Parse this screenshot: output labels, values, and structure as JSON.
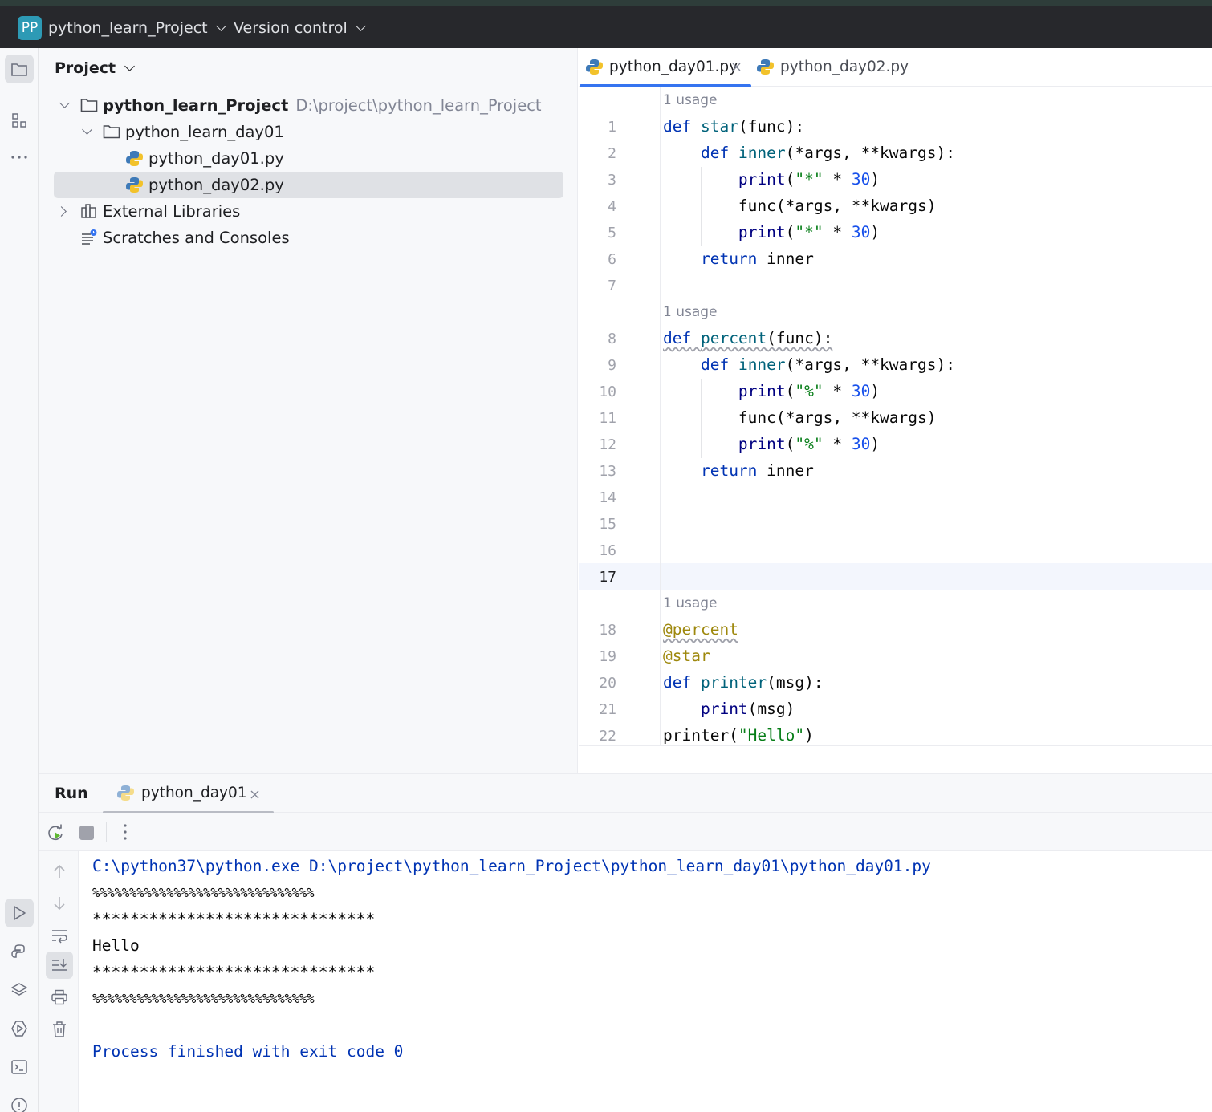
{
  "titlebar": {
    "project_badge": "PP",
    "project_name": "python_learn_Project",
    "vcs": "Version control"
  },
  "toolstrip": {
    "top": [
      "folder-icon",
      "structure-icon",
      "more-icon"
    ],
    "bottom": [
      "run-icon",
      "python-console-icon",
      "layers-icon",
      "services-icon",
      "terminal-icon",
      "problems-icon"
    ]
  },
  "project_panel": {
    "title": "Project",
    "tree": {
      "root": {
        "label": "python_learn_Project",
        "path": "D:\\project\\python_learn_Project"
      },
      "folder": "python_learn_day01",
      "file1": "python_day01.py",
      "file2": "python_day02.py",
      "external": "External Libraries",
      "scratches": "Scratches and Consoles"
    }
  },
  "editor": {
    "tabs": [
      {
        "label": "python_day01.py",
        "active": true
      },
      {
        "label": "python_day02.py",
        "active": false
      }
    ],
    "usage_hint": "1 usage",
    "line_numbers": [
      "1",
      "2",
      "3",
      "4",
      "5",
      "6",
      "7",
      "8",
      "9",
      "10",
      "11",
      "12",
      "13",
      "14",
      "15",
      "16",
      "17",
      "18",
      "19",
      "20",
      "21",
      "22"
    ],
    "current_line": "17",
    "code": {
      "l1": [
        "def",
        " ",
        "star",
        "(func):"
      ],
      "l2": [
        "    ",
        "def",
        " ",
        "inner",
        "(*args, **kwargs):"
      ],
      "l3": [
        "        ",
        "print",
        "(",
        "\"*\"",
        " * ",
        "30",
        ")"
      ],
      "l4": [
        "        ",
        "func(*args, **kwargs)"
      ],
      "l5": [
        "        ",
        "print",
        "(",
        "\"*\"",
        " * ",
        "30",
        ")"
      ],
      "l6": [
        "    ",
        "return",
        " inner"
      ],
      "l8": [
        "def",
        " ",
        "percent",
        "(func):"
      ],
      "l9": [
        "    ",
        "def",
        " ",
        "inner",
        "(*args, **kwargs):"
      ],
      "l10": [
        "        ",
        "print",
        "(",
        "\"%\"",
        " * ",
        "30",
        ")"
      ],
      "l11": [
        "        ",
        "func(*args, **kwargs)"
      ],
      "l12": [
        "        ",
        "print",
        "(",
        "\"%\"",
        " * ",
        "30",
        ")"
      ],
      "l13": [
        "    ",
        "return",
        " inner"
      ],
      "l18": "@percent",
      "l19": "@star",
      "l20": [
        "def",
        " ",
        "printer",
        "(msg):"
      ],
      "l21": [
        "    ",
        "print",
        "(msg)"
      ],
      "l22": [
        "printer(",
        "\"Hello\"",
        ")"
      ]
    }
  },
  "run": {
    "title": "Run",
    "tab": "python_day01",
    "output": [
      "C:\\python37\\python.exe D:\\project\\python_learn_Project\\python_learn_day01\\python_day01.py",
      "%%%%%%%%%%%%%%%%%%%%%%%%%%%%%%",
      "******************************",
      "Hello",
      "******************************",
      "%%%%%%%%%%%%%%%%%%%%%%%%%%%%%%",
      "",
      "Process finished with exit code 0"
    ]
  },
  "colors": {
    "accent": "#3574f0",
    "keyword": "#0033b3",
    "function": "#00627a",
    "string": "#067d17",
    "number": "#1750eb",
    "decorator": "#9e880d",
    "titlebar_bg": "#27282c"
  }
}
